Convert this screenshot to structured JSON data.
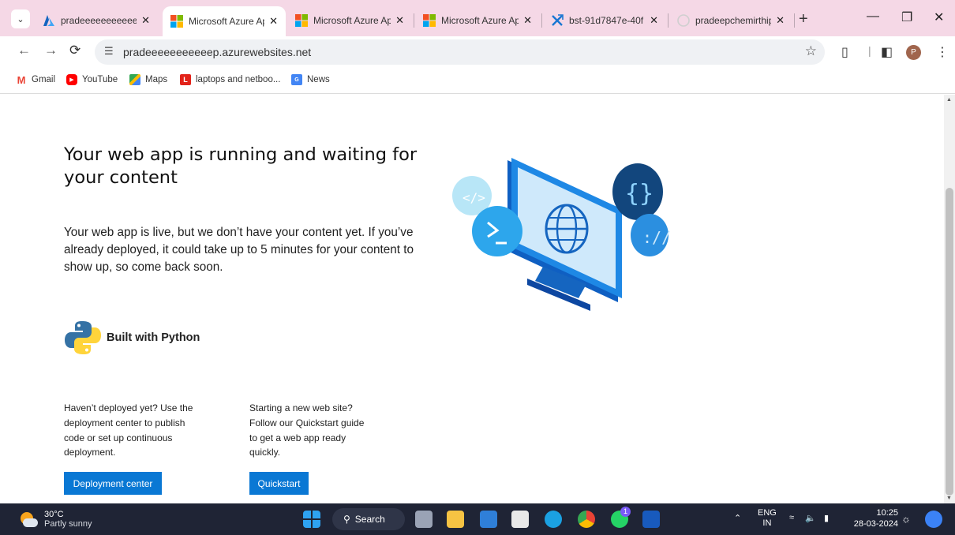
{
  "browser": {
    "tabs": [
      {
        "title": "pradeeeeeeeeeeep",
        "favicon": "azure-a-icon",
        "active": false
      },
      {
        "title": "Microsoft Azure Ap",
        "favicon": "microsoft-icon",
        "active": true
      },
      {
        "title": "Microsoft Azure Ap",
        "favicon": "microsoft-icon",
        "active": false
      },
      {
        "title": "Microsoft Azure Ap",
        "favicon": "microsoft-icon",
        "active": false
      },
      {
        "title": "bst-91d7847e-40f",
        "favicon": "kudu-icon",
        "active": false
      },
      {
        "title": "pradeepchemirthip",
        "favicon": "github-icon",
        "active": false
      }
    ],
    "url": "pradeeeeeeeeeeep.azurewebsites.net",
    "avatar_letter": "P",
    "bookmarks": [
      {
        "label": "Gmail",
        "icon": "gmail-icon"
      },
      {
        "label": "YouTube",
        "icon": "youtube-icon"
      },
      {
        "label": "Maps",
        "icon": "maps-icon"
      },
      {
        "label": "laptops and netboo...",
        "icon": "lenovo-icon"
      },
      {
        "label": "News",
        "icon": "news-icon"
      }
    ]
  },
  "page": {
    "heading": "Your web app is running and waiting for your content",
    "lead": "Your web app is live, but we don’t have your content yet. If you’ve already deployed, it could take up to 5 minutes for your content to show up, so come back soon.",
    "built_with": "Built with Python",
    "left_col": "Haven’t deployed yet? Use the deployment center to publish code or set up continuous deployment.",
    "right_col": "Starting a new web site? Follow our Quickstart guide to get a web app ready quickly.",
    "deploy_button": "Deployment center",
    "quickstart_button": "Quickstart",
    "accent": "#0a78d4"
  },
  "taskbar": {
    "temperature": "30°C",
    "weather": "Partly sunny",
    "search_label": "Search",
    "lang_top": "ENG",
    "lang_bottom": "IN",
    "time": "10:25",
    "date": "28-03-2024",
    "whatsapp_badge": "1"
  }
}
